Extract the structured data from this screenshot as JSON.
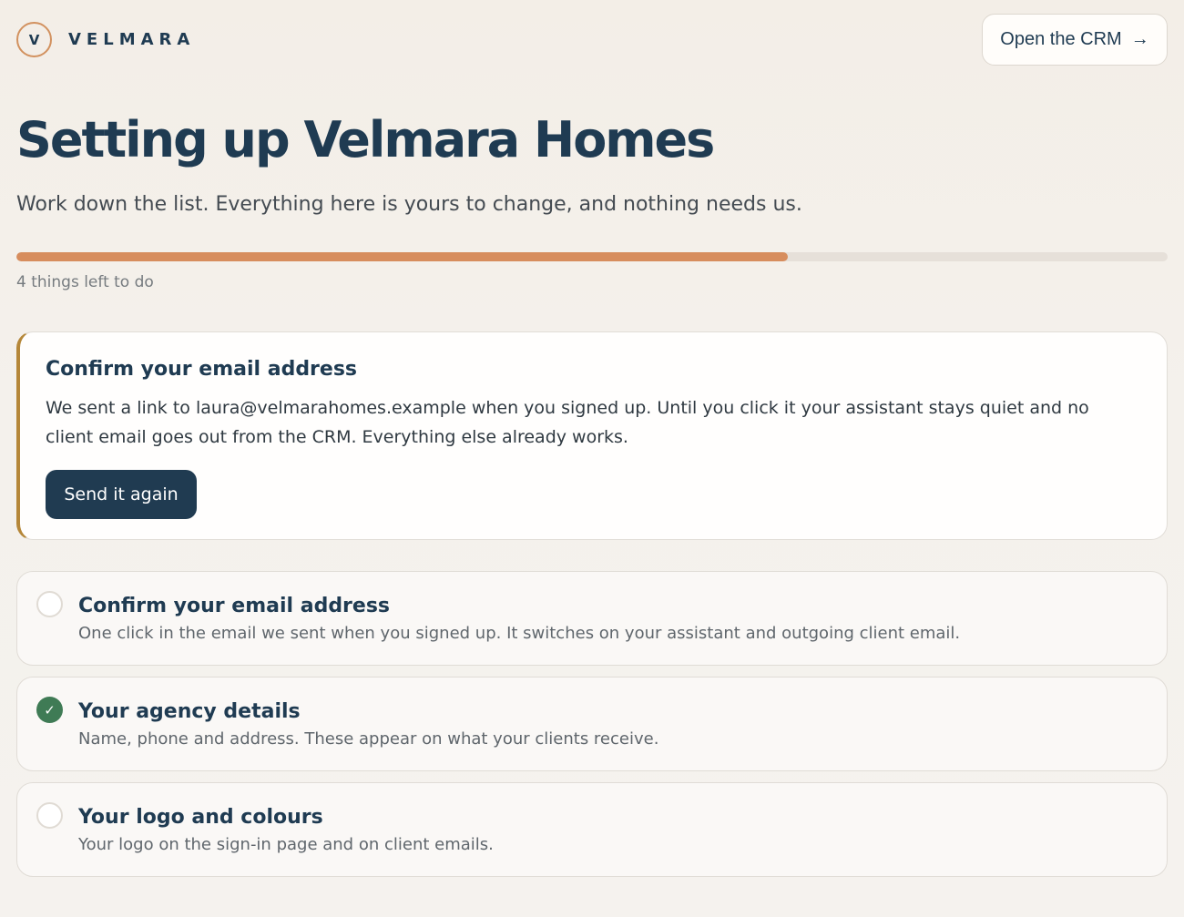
{
  "header": {
    "logo_letter": "V",
    "brand_name": "VELMARA",
    "crm_button_label": "Open the CRM",
    "crm_button_arrow": "→"
  },
  "hero": {
    "title": "Setting up Velmara Homes",
    "subtitle": "Work down the list. Everything here is yours to change, and nothing needs us."
  },
  "progress": {
    "remaining_text": "4 things left to do",
    "fill_percent": 67
  },
  "callout": {
    "title": "Confirm your email address",
    "body": "We sent a link to laura@velmarahomes.example when you signed up. Until you click it your assistant stays quiet and no client email goes out from the CRM. Everything else already works.",
    "button_label": "Send it again",
    "accent_color": "#b58739"
  },
  "tasks": [
    {
      "title": "Confirm your email address",
      "description": "One click in the email we sent when you signed up. It switches on your assistant and outgoing client email.",
      "status": "todo"
    },
    {
      "title": "Your agency details",
      "description": "Name, phone and address. These appear on what your clients receive.",
      "status": "done",
      "status_glyph": "✓"
    },
    {
      "title": "Your logo and colours",
      "description": "Your logo on the sign-in page and on client emails.",
      "status": "todo"
    }
  ],
  "colors": {
    "primary_text": "#1f3b52",
    "progress_fill": "#d78d5d",
    "done_status": "#3f7b55",
    "primary_button": "#203b51"
  }
}
